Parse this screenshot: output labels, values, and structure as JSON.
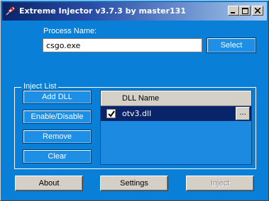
{
  "window": {
    "title": "Extreme Injector v3.7.3 by master131",
    "background": "#0a7fd8",
    "controls": [
      "minimize-icon",
      "maximize-icon",
      "close-icon"
    ]
  },
  "process": {
    "label": "Process Name:",
    "value": "csgo.exe",
    "select_label": "Select"
  },
  "inject_list": {
    "label": "Inject List",
    "buttons": [
      "Add DLL",
      "Enable/Disable",
      "Remove",
      "Clear"
    ],
    "column_header": "DLL Name",
    "rows": [
      {
        "name": "otv3.dll",
        "checked": true,
        "browse_label": "..."
      }
    ]
  },
  "footer": {
    "about": "About",
    "settings": "Settings",
    "inject": "Inject",
    "inject_enabled": false
  }
}
